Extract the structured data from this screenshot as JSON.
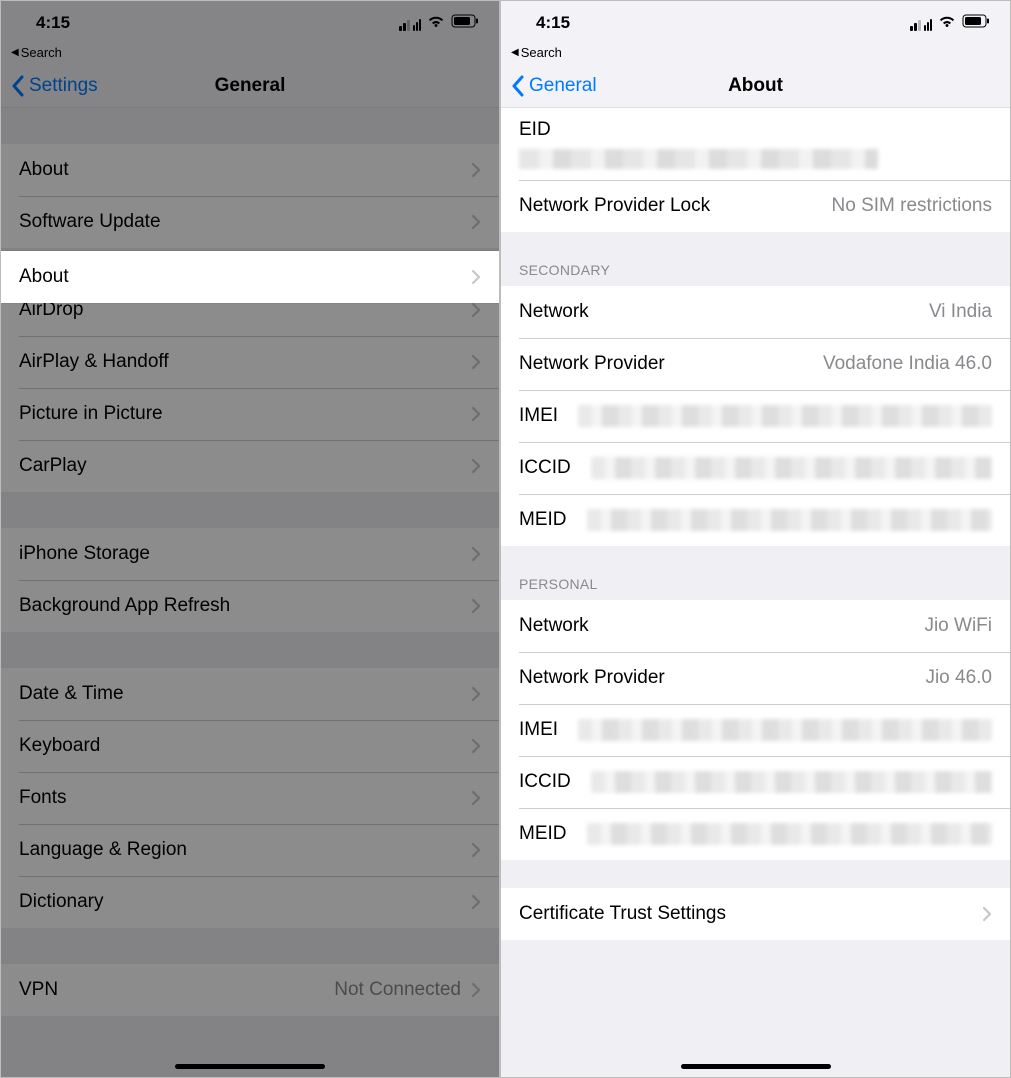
{
  "status": {
    "time": "4:15"
  },
  "left": {
    "breadcrumb": "Search",
    "back_label": "Settings",
    "title": "General",
    "groups": [
      {
        "rows": [
          {
            "label": "About",
            "highlight": true
          },
          {
            "label": "Software Update"
          }
        ]
      },
      {
        "rows": [
          {
            "label": "AirDrop"
          },
          {
            "label": "AirPlay & Handoff"
          },
          {
            "label": "Picture in Picture"
          },
          {
            "label": "CarPlay"
          }
        ]
      },
      {
        "rows": [
          {
            "label": "iPhone Storage"
          },
          {
            "label": "Background App Refresh"
          }
        ]
      },
      {
        "rows": [
          {
            "label": "Date & Time"
          },
          {
            "label": "Keyboard"
          },
          {
            "label": "Fonts"
          },
          {
            "label": "Language & Region"
          },
          {
            "label": "Dictionary"
          }
        ]
      },
      {
        "rows": [
          {
            "label": "VPN",
            "value": "Not Connected"
          }
        ]
      }
    ]
  },
  "right": {
    "breadcrumb": "Search",
    "back_label": "General",
    "title": "About",
    "top_rows": [
      {
        "label": "EID",
        "redacted": true,
        "tall": true
      },
      {
        "label": "Network Provider Lock",
        "value": "No SIM restrictions"
      }
    ],
    "sections": [
      {
        "header": "SECONDARY",
        "rows": [
          {
            "label": "Network",
            "value": "Vi India"
          },
          {
            "label": "Network Provider",
            "value": "Vodafone India 46.0"
          },
          {
            "label": "IMEI",
            "redacted": true
          },
          {
            "label": "ICCID",
            "redacted": true
          },
          {
            "label": "MEID",
            "redacted": true
          }
        ]
      },
      {
        "header": "PERSONAL",
        "rows": [
          {
            "label": "Network",
            "value": "Jio WiFi"
          },
          {
            "label": "Network Provider",
            "value": "Jio 46.0"
          },
          {
            "label": "IMEI",
            "redacted": true
          },
          {
            "label": "ICCID",
            "redacted": true
          },
          {
            "label": "MEID",
            "redacted": true
          }
        ]
      }
    ],
    "cert_row": {
      "label": "Certificate Trust Settings"
    }
  }
}
